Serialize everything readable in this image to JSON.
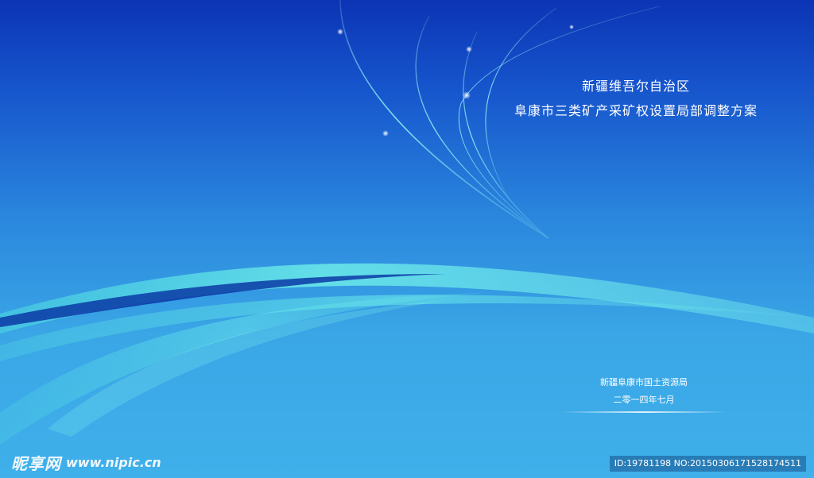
{
  "cover": {
    "title_line1": "新疆维吾尔自治区",
    "title_line2": "阜康市三类矿产采矿权设置局部调整方案",
    "issuer": "新疆阜康市国土资源局",
    "issue_date": "二零一四年七月"
  },
  "watermark": {
    "site_name_cn": "昵享网",
    "site_url": "www.nipic.cn",
    "image_id": "ID:19781198 NO:20150306171528174511"
  },
  "colors": {
    "background_top": "#0c34b4",
    "background_bottom": "#3fb0ea",
    "wave_cyan": "#6ff0ea",
    "wave_dark_blue": "#0a3aa6",
    "text": "#ffffff"
  }
}
